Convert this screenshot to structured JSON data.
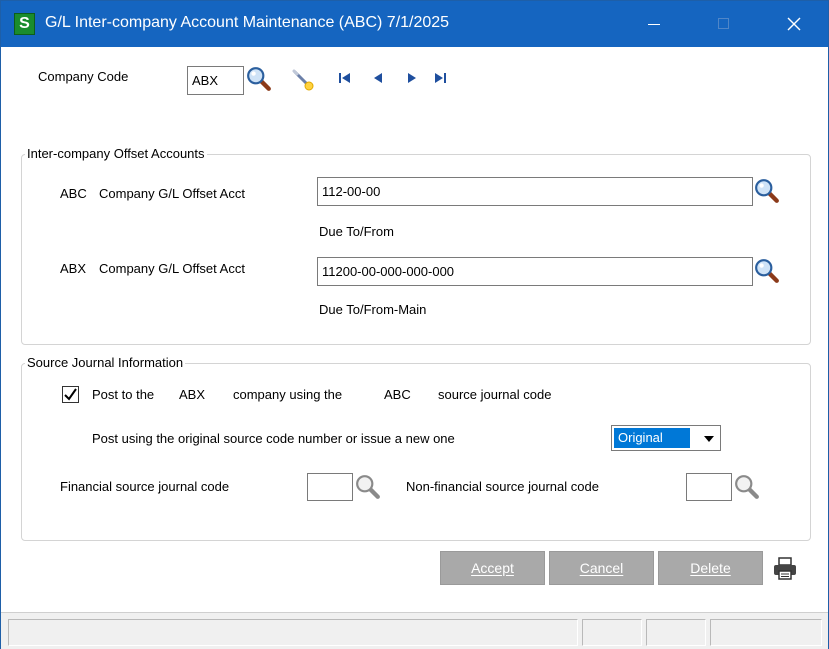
{
  "window": {
    "title": "G/L Inter-company Account Maintenance (ABC) 7/1/2025",
    "app_icon_letter": "S"
  },
  "header": {
    "company_code_label": "Company Code",
    "company_code_value": "ABX"
  },
  "offset_group": {
    "legend": "Inter-company Offset Accounts",
    "row1": {
      "company": "ABC",
      "label": "Company G/L Offset Acct",
      "value": "112-00-00",
      "description": "Due To/From"
    },
    "row2": {
      "company": "ABX",
      "label": "Company G/L Offset Acct",
      "value": "11200-00-000-000-000",
      "description": "Due To/From-Main"
    }
  },
  "source_group": {
    "legend": "Source Journal Information",
    "post_checkbox_checked": true,
    "post_prefix": "Post to the",
    "post_company": "ABX",
    "post_middle": "company using the",
    "post_source_company": "ABC",
    "post_suffix": "source journal code",
    "post_using_label": "Post using the original source code number or issue a new one",
    "post_using_selected": "Original",
    "financial_label": "Financial source journal code",
    "financial_value": "",
    "nonfinancial_label": "Non-financial source journal  code",
    "nonfinancial_value": ""
  },
  "buttons": {
    "accept": "Accept",
    "cancel": "Cancel",
    "delete": "Delete"
  },
  "colors": {
    "titlebar": "#1565c0",
    "selection": "#0078d7",
    "button_disabled": "#a9a9a9",
    "app_icon": "#1a8c2e"
  },
  "icons": {
    "lookup": "magnifier-icon",
    "wizard": "wand-icon",
    "first": "first-record-icon",
    "prev": "previous-record-icon",
    "next": "next-record-icon",
    "last": "last-record-icon",
    "print": "printer-icon"
  }
}
